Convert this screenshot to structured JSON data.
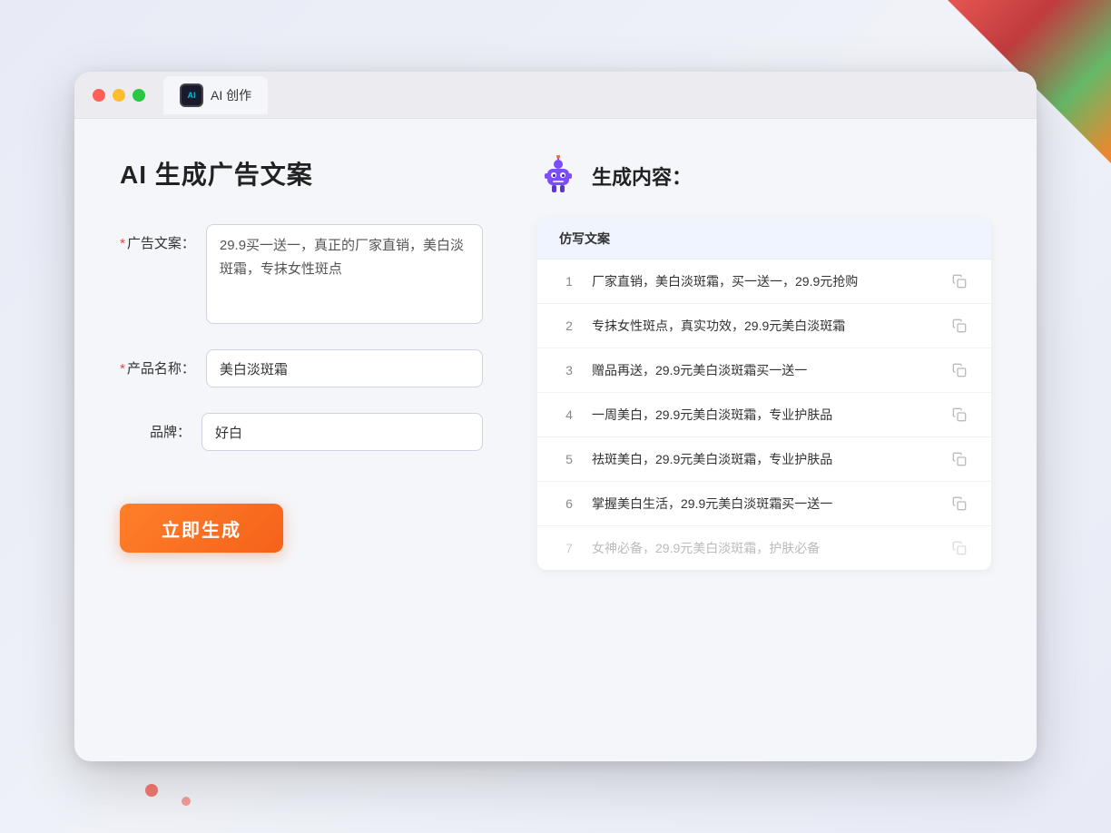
{
  "window": {
    "tab_label": "AI 创作"
  },
  "page": {
    "title": "AI 生成广告文案",
    "right_section_title": "生成内容："
  },
  "form": {
    "ad_copy_label": "广告文案：",
    "ad_copy_required": true,
    "ad_copy_value": "29.9买一送一，真正的厂家直销，美白淡斑霜，专抹女性斑点",
    "product_name_label": "产品名称：",
    "product_name_required": true,
    "product_name_value": "美白淡斑霜",
    "brand_label": "品牌：",
    "brand_required": false,
    "brand_value": "好白",
    "generate_button_label": "立即生成"
  },
  "results": {
    "column_header": "仿写文案",
    "items": [
      {
        "num": "1",
        "text": "厂家直销，美白淡斑霜，买一送一，29.9元抢购",
        "faded": false
      },
      {
        "num": "2",
        "text": "专抹女性斑点，真实功效，29.9元美白淡斑霜",
        "faded": false
      },
      {
        "num": "3",
        "text": "赠品再送，29.9元美白淡斑霜买一送一",
        "faded": false
      },
      {
        "num": "4",
        "text": "一周美白，29.9元美白淡斑霜，专业护肤品",
        "faded": false
      },
      {
        "num": "5",
        "text": "祛斑美白，29.9元美白淡斑霜，专业护肤品",
        "faded": false
      },
      {
        "num": "6",
        "text": "掌握美白生活，29.9元美白淡斑霜买一送一",
        "faded": false
      },
      {
        "num": "7",
        "text": "女神必备，29.9元美白淡斑霜，护肤必备",
        "faded": true
      }
    ]
  },
  "colors": {
    "accent_orange": "#f5621a",
    "required_red": "#f44336",
    "table_header_bg": "#f0f4ff"
  }
}
